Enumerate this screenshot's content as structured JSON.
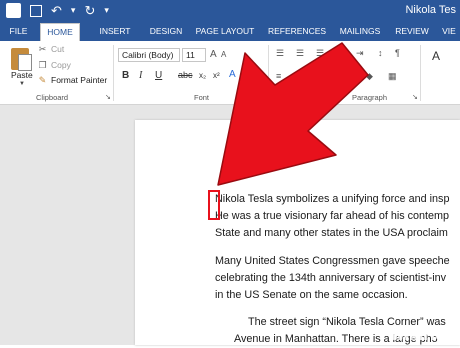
{
  "window": {
    "title": "Nikola Tes"
  },
  "ribbon_tabs": [
    {
      "label": "FILE"
    },
    {
      "label": "HOME"
    },
    {
      "label": "INSERT"
    },
    {
      "label": "DESIGN"
    },
    {
      "label": "PAGE LAYOUT"
    },
    {
      "label": "REFERENCES"
    },
    {
      "label": "MAILINGS"
    },
    {
      "label": "REVIEW"
    },
    {
      "label": "VIE"
    }
  ],
  "clipboard": {
    "paste_label": "Paste",
    "cut_label": "Cut",
    "copy_label": "Copy",
    "format_painter_label": "Format Painter",
    "group_label": "Clipboard"
  },
  "font": {
    "family_value": "Calibri (Body)",
    "size_value": "11",
    "group_label": "Font"
  },
  "paragraph": {
    "group_label": "Paragraph"
  },
  "document": {
    "lines": [
      "Nikola Tesla symbolizes a unifying force and insp",
      "He was a true visionary far ahead of his contemp",
      "State and many other states in the USA proclaim",
      "Many United States Congressmen gave speeche",
      "celebrating the 134th anniversary of scientist-inv",
      "in the US Senate on the same occasion.",
      "The street sign “Nikola Tesla Corner” was",
      "Avenue in Manhattan. There is a large pho"
    ]
  },
  "watermark": "wikiHow",
  "colors": {
    "word_blue": "#2b579a",
    "annotation_red": "#e8111c",
    "workspace_gray": "#e6e6e6"
  }
}
